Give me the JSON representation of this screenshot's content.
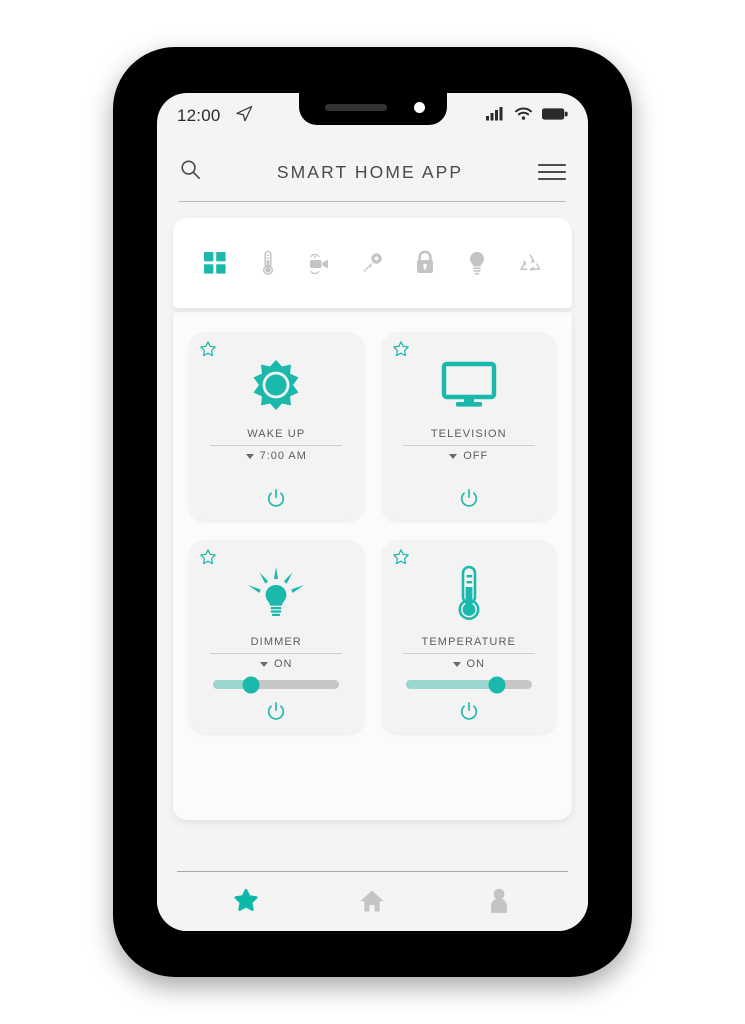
{
  "status_bar": {
    "time": "12:00",
    "nav_icon": "send-arrow-icon",
    "signal_icon": "signal-bars-icon",
    "wifi_icon": "wifi-icon",
    "battery_icon": "battery-full-icon"
  },
  "header": {
    "title": "SMART HOME APP",
    "search_icon": "search-icon",
    "menu_icon": "hamburger-menu-icon"
  },
  "toolbar": {
    "items": [
      {
        "name": "grid",
        "icon": "grid-icon",
        "active": true
      },
      {
        "name": "thermostat",
        "icon": "thermometer-icon",
        "active": false
      },
      {
        "name": "camera",
        "icon": "camera-icon",
        "active": false
      },
      {
        "name": "key",
        "icon": "key-icon",
        "active": false
      },
      {
        "name": "lock",
        "icon": "lock-icon",
        "active": false
      },
      {
        "name": "light",
        "icon": "bulb-icon",
        "active": false
      },
      {
        "name": "eco",
        "icon": "recycle-icon",
        "active": false
      }
    ]
  },
  "tiles": [
    {
      "label": "WAKE UP",
      "status": "7:00 AM",
      "icon": "sun-icon",
      "favorite": false,
      "has_slider": false,
      "power_icon": "power-icon"
    },
    {
      "label": "TELEVISION",
      "status": "OFF",
      "icon": "television-icon",
      "favorite": false,
      "has_slider": false,
      "power_icon": "power-icon"
    },
    {
      "label": "DIMMER",
      "status": "ON",
      "icon": "light-bulb-icon",
      "favorite": false,
      "has_slider": true,
      "slider_value": 30,
      "power_icon": "power-icon"
    },
    {
      "label": "TEMPERATURE",
      "status": "ON",
      "icon": "thermometer-icon",
      "favorite": false,
      "has_slider": true,
      "slider_value": 72,
      "power_icon": "power-icon"
    }
  ],
  "bottom_nav": {
    "items": [
      {
        "name": "favorites",
        "icon": "star-filled-icon",
        "active": true
      },
      {
        "name": "home",
        "icon": "home-icon",
        "active": false
      },
      {
        "name": "profile",
        "icon": "person-icon",
        "active": false
      }
    ]
  },
  "colors": {
    "accent": "#1bb8ac",
    "accent_light": "#9ad6d0",
    "inactive": "#c4c4c4",
    "text": "#5c5c5c",
    "frame": "#000000"
  }
}
